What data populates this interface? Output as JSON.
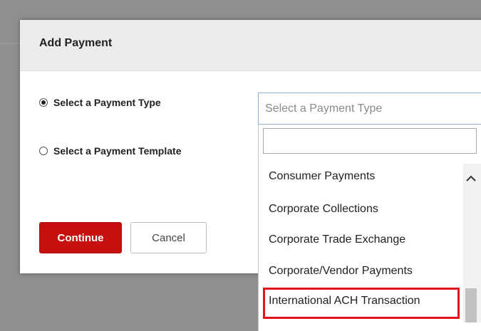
{
  "modal": {
    "title": "Add Payment",
    "options": [
      {
        "label": "Select a Payment Type",
        "selected": true
      },
      {
        "label": "Select a Payment Template",
        "selected": false
      }
    ],
    "continue_label": "Continue",
    "cancel_label": "Cancel"
  },
  "payment_type_select": {
    "placeholder": "Select a Payment Type",
    "search_value": "",
    "options": [
      "Consumer Payments",
      "Corporate Collections",
      "Corporate Trade Exchange",
      "Corporate/Vendor Payments",
      "International ACH Transaction"
    ],
    "highlighted_option": "International ACH Transaction"
  },
  "icons": {
    "search": "search-icon",
    "scroll_up": "chevron-up-icon"
  },
  "colors": {
    "primary_button": "#c80f0f",
    "highlight_border": "#e2141c",
    "select_border": "#8fb0d6"
  }
}
